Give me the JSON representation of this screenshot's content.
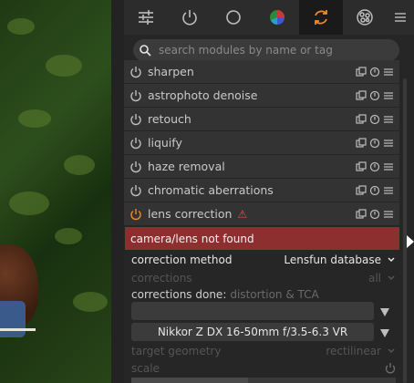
{
  "search": {
    "placeholder": "search modules by name or tag"
  },
  "tabs": [
    {
      "icon": "sliders-icon"
    },
    {
      "icon": "power-icon"
    },
    {
      "icon": "circle-icon"
    },
    {
      "icon": "color-wheel-icon"
    },
    {
      "icon": "correct-icon",
      "active": true
    },
    {
      "icon": "effect-icon"
    },
    {
      "icon": "menu-icon"
    }
  ],
  "modules": [
    {
      "label": "sharpen"
    },
    {
      "label": "astrophoto denoise"
    },
    {
      "label": "retouch"
    },
    {
      "label": "liquify"
    },
    {
      "label": "haze removal"
    },
    {
      "label": "chromatic aberrations"
    },
    {
      "label": "lens correction",
      "warning": "⚠",
      "enabled": true
    }
  ],
  "error": {
    "text": "camera/lens not found"
  },
  "lens": {
    "correction_method_label": "correction method",
    "correction_method_value": "Lensfun database",
    "corrections_label": "corrections",
    "corrections_value": "all",
    "done_label": "corrections done:",
    "done_value": "distortion & TCA",
    "camera_value": "",
    "lens_value": "Nikkor Z DX 16-50mm f/3.5-6.3 VR",
    "target_geometry_label": "target geometry",
    "target_geometry_value": "rectilinear",
    "scale_label": "scale"
  },
  "colors": {
    "accent": "#f08a2a",
    "error": "#8e2f2f"
  }
}
